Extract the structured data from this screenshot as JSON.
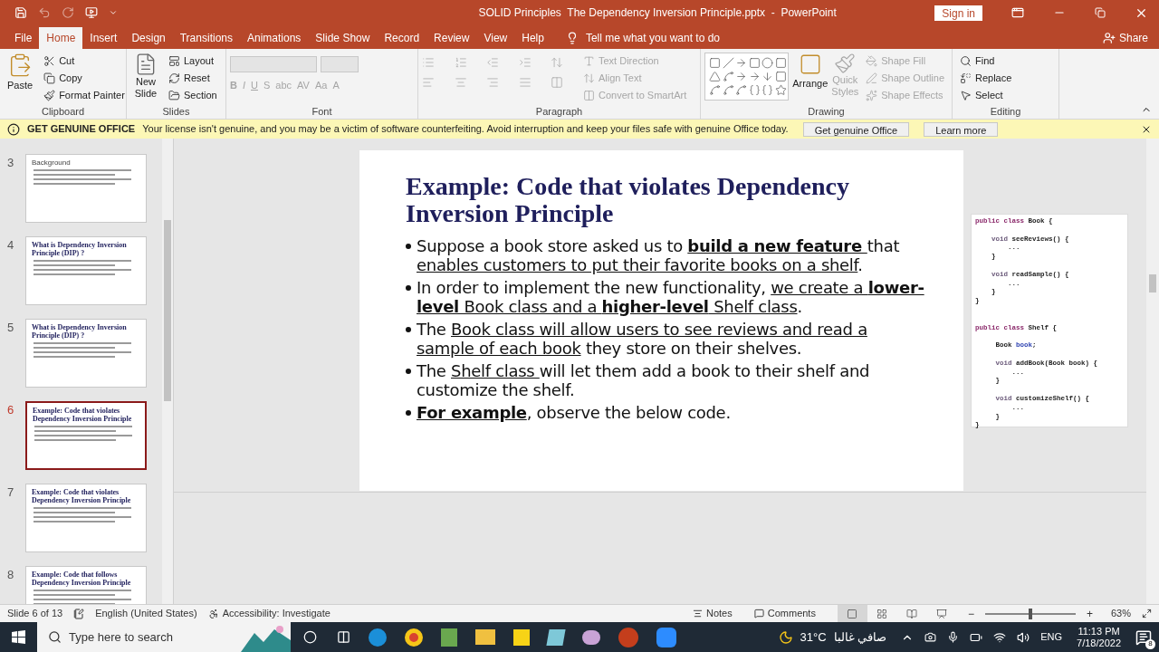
{
  "title_bar": {
    "title": "SOLID Principles  The Dependency Inversion Principle.pptx  -  PowerPoint",
    "sign_in": "Sign in"
  },
  "tabs": [
    {
      "label": "File",
      "selected": false
    },
    {
      "label": "Home",
      "selected": true
    },
    {
      "label": "Insert",
      "selected": false
    },
    {
      "label": "Design",
      "selected": false
    },
    {
      "label": "Transitions",
      "selected": false
    },
    {
      "label": "Animations",
      "selected": false
    },
    {
      "label": "Slide Show",
      "selected": false
    },
    {
      "label": "Record",
      "selected": false
    },
    {
      "label": "Review",
      "selected": false
    },
    {
      "label": "View",
      "selected": false
    },
    {
      "label": "Help",
      "selected": false
    }
  ],
  "tell_me": "Tell me what you want to do",
  "share": "Share",
  "ribbon": {
    "clipboard": {
      "label": "Clipboard",
      "paste": "Paste",
      "items": [
        {
          "kind": "cut",
          "label": "Cut",
          "disabled": false
        },
        {
          "kind": "copy",
          "label": "Copy",
          "disabled": false
        },
        {
          "kind": "painter",
          "label": "Format Painter",
          "disabled": false
        }
      ]
    },
    "slides": {
      "label": "Slides",
      "new_slide": [
        "New",
        "Slide"
      ],
      "items": [
        {
          "kind": "layout",
          "label": "Layout",
          "disabled": false
        },
        {
          "kind": "reset",
          "label": "Reset",
          "disabled": false
        },
        {
          "kind": "section",
          "label": "Section",
          "disabled": false
        }
      ]
    },
    "font": {
      "label": "Font",
      "buttons": [
        "B",
        "I",
        "U",
        "S",
        "abc",
        "AV",
        "Aa",
        "A"
      ]
    },
    "paragraph": {
      "label": "Paragraph",
      "items": [
        {
          "kind": "direction",
          "label": "Text Direction",
          "disabled": true
        },
        {
          "kind": "align",
          "label": "Align Text",
          "disabled": true
        },
        {
          "kind": "smartart",
          "label": "Convert to SmartArt",
          "disabled": true
        }
      ]
    },
    "drawing": {
      "label": "Drawing",
      "arrange": "Arrange",
      "quick_styles": [
        "Quick",
        "Styles"
      ],
      "items": [
        {
          "kind": "fill",
          "label": "Shape Fill",
          "disabled": true
        },
        {
          "kind": "outline",
          "label": "Shape Outline",
          "disabled": true
        },
        {
          "kind": "effects",
          "label": "Shape Effects",
          "disabled": true
        }
      ]
    },
    "editing": {
      "label": "Editing",
      "items": [
        {
          "kind": "find",
          "label": "Find",
          "disabled": false
        },
        {
          "kind": "replace",
          "label": "Replace",
          "disabled": false
        },
        {
          "kind": "select",
          "label": "Select",
          "disabled": false
        }
      ]
    }
  },
  "message_bar": {
    "heading": "GET GENUINE OFFICE",
    "text": "Your license isn't genuine, and you may be a victim of software counterfeiting. Avoid interruption and keep your files safe with genuine Office today.",
    "buttons": [
      "Get genuine Office",
      "Learn more"
    ]
  },
  "thumbnails": [
    {
      "number": "3",
      "title": "Background",
      "kind": "plain",
      "selected": false
    },
    {
      "number": "4",
      "title": "What is Dependency Inversion Principle (DIP) ?",
      "kind": "heading",
      "selected": false
    },
    {
      "number": "5",
      "title": "What is Dependency Inversion Principle (DIP) ?",
      "kind": "heading",
      "selected": false
    },
    {
      "number": "6",
      "title": "Example: Code that violates Dependency Inversion Principle",
      "kind": "heading",
      "selected": true
    },
    {
      "number": "7",
      "title": "Example: Code that violates Dependency Inversion Principle",
      "kind": "heading",
      "selected": false
    },
    {
      "number": "8",
      "title": "Example: Code that follows Dependency Inversion Principle",
      "kind": "heading",
      "selected": false
    }
  ],
  "slide": {
    "title": "Example: Code that violates Dependency Inversion Principle",
    "bullets": [
      [
        {
          "t": "Suppose a book store asked us to "
        },
        {
          "t": "build a new feature ",
          "bold": true,
          "underline": true
        },
        {
          "t": "that "
        },
        {
          "t": "enables customers to put their favorite books on a shelf",
          "underline": true
        },
        {
          "t": "."
        }
      ],
      [
        {
          "t": "In order to implement the new functionality, "
        },
        {
          "t": "we create a ",
          "underline": true
        },
        {
          "t": "lower-level",
          "bold": true,
          "underline": true
        },
        {
          "t": " Book class and a ",
          "underline": true
        },
        {
          "t": "higher-level",
          "bold": true,
          "underline": true
        },
        {
          "t": " Shelf class",
          "underline": true
        },
        {
          "t": "."
        }
      ],
      [
        {
          "t": "The "
        },
        {
          "t": "Book class will allow users to see reviews and read a sample of each book",
          "underline": true
        },
        {
          "t": " they store on their shelves."
        }
      ],
      [
        {
          "t": "The "
        },
        {
          "t": "Shelf class ",
          "underline": true
        },
        {
          "t": "will let them add a book to their shelf and customize the shelf."
        }
      ],
      [
        {
          "t": "For example",
          "bold": true,
          "underline": true
        },
        {
          "t": ", observe the below code."
        }
      ]
    ]
  },
  "code": [
    {
      "lines": [
        {
          "gap_before": false,
          "segments": [
            {
              "t": "public class",
              "kind": "keyword"
            },
            {
              "t": " Book {"
            }
          ]
        },
        {
          "gap_before": true,
          "segments": [
            {
              "t": "    void",
              "kind": "type"
            },
            {
              "t": " seeReviews() {"
            }
          ]
        },
        {
          "gap_before": false,
          "segments": [
            {
              "t": "        ..."
            }
          ]
        },
        {
          "gap_before": false,
          "segments": [
            {
              "t": "    }"
            }
          ]
        },
        {
          "gap_before": true,
          "segments": [
            {
              "t": "    void",
              "kind": "type"
            },
            {
              "t": " readSample() {"
            }
          ]
        },
        {
          "gap_before": false,
          "segments": [
            {
              "t": "        ..."
            }
          ]
        },
        {
          "gap_before": false,
          "segments": [
            {
              "t": "    }"
            }
          ]
        },
        {
          "gap_before": false,
          "segments": [
            {
              "t": "}"
            }
          ]
        }
      ]
    },
    {
      "lines": [
        {
          "gap_before": false,
          "segments": [
            {
              "t": "public class",
              "kind": "keyword"
            },
            {
              "t": " Shelf {"
            }
          ]
        },
        {
          "gap_before": true,
          "segments": [
            {
              "t": "     Book "
            },
            {
              "t": "book",
              "kind": "field"
            },
            {
              "t": ";"
            }
          ]
        },
        {
          "gap_before": true,
          "segments": [
            {
              "t": "     void",
              "kind": "type"
            },
            {
              "t": " addBook(Book book) {"
            }
          ]
        },
        {
          "gap_before": false,
          "segments": [
            {
              "t": "         ..."
            }
          ]
        },
        {
          "gap_before": false,
          "segments": [
            {
              "t": "     }"
            }
          ]
        },
        {
          "gap_before": true,
          "segments": [
            {
              "t": "     void",
              "kind": "type"
            },
            {
              "t": " customizeShelf() {"
            }
          ]
        },
        {
          "gap_before": false,
          "segments": [
            {
              "t": "         ..."
            }
          ]
        },
        {
          "gap_before": false,
          "segments": [
            {
              "t": "     }"
            }
          ]
        },
        {
          "gap_before": false,
          "segments": [
            {
              "t": "}"
            }
          ]
        }
      ]
    }
  ],
  "status_bar": {
    "slide": "Slide 6 of 13",
    "language": "English (United States)",
    "accessibility": "Accessibility: Investigate",
    "notes": "Notes",
    "comments": "Comments",
    "views": [
      {
        "kind": "normal",
        "selected": true
      },
      {
        "kind": "sorter",
        "selected": false
      },
      {
        "kind": "reading",
        "selected": false
      },
      {
        "kind": "show",
        "selected": false
      }
    ],
    "zoom": {
      "level": 0.5,
      "minus": "−",
      "plus": "+",
      "reading": "63%"
    }
  },
  "taskbar": {
    "search_placeholder": "Type here to search",
    "weather": {
      "temp": "31°C",
      "text": "صافي غالبا"
    },
    "language": "ENG",
    "time": "11:13 PM",
    "date": "7/18/2022",
    "notifications": "8"
  }
}
